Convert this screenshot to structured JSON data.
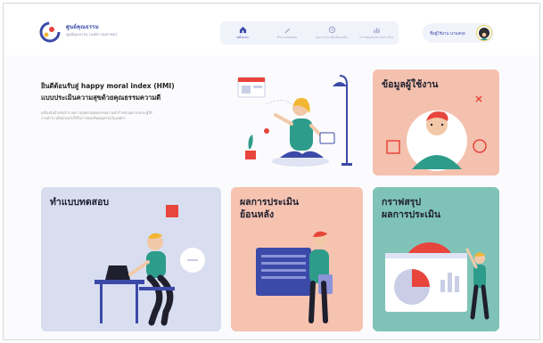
{
  "header": {
    "brand_title": "ศูนย์คุณธรรม",
    "brand_subtitle": "ศูนย์คุณธรรม (องค์การมหาชน)",
    "nav": [
      {
        "label": "หน้าแรก",
        "icon": "home-icon",
        "active": true
      },
      {
        "label": "ทำแบบทดสอบ",
        "icon": "pen-icon",
        "active": false
      },
      {
        "label": "ผลการประเมินย้อนหลัง",
        "icon": "history-icon",
        "active": false
      },
      {
        "label": "กราฟสรุปผลการประเมิน",
        "icon": "chart-icon",
        "active": false
      }
    ],
    "user_name": "ชื่อผู้ใช้งาน นามสกุล"
  },
  "hero": {
    "title_line1": "ยินดีต้อนรับสู่ happy moral index (HMI)",
    "title_line2": "แบบประเมินความสุขด้วยคุณธรรมความดี",
    "body": "เครื่องมือสำหรับสำรวจความสุขด้วยคุณธรรมความดี สำหรับบุคลากรและผู้ใช้งานทั่วไป เพื่อนำผลไปใช้ในการส่งเสริมคุณธรรมในองค์กร"
  },
  "cards": {
    "user": {
      "title": "ข้อมูลผู้ใช้งาน"
    },
    "test": {
      "title": "ทำแบบทดสอบ"
    },
    "result": {
      "title_line1": "ผลการประเมิน",
      "title_line2": "ย้อนหลัง"
    },
    "graph": {
      "title_line1": "กราฟสรุป",
      "title_line2": "ผลการประเมิน"
    }
  },
  "colors": {
    "brand": "#3b4aa8",
    "card_user": "#f4c1ae",
    "card_test": "#d8def0",
    "card_result": "#f6c3b1",
    "card_graph": "#7fc3b8",
    "accent_red": "#e8453c",
    "teal_shirt": "#2e9c8b"
  }
}
